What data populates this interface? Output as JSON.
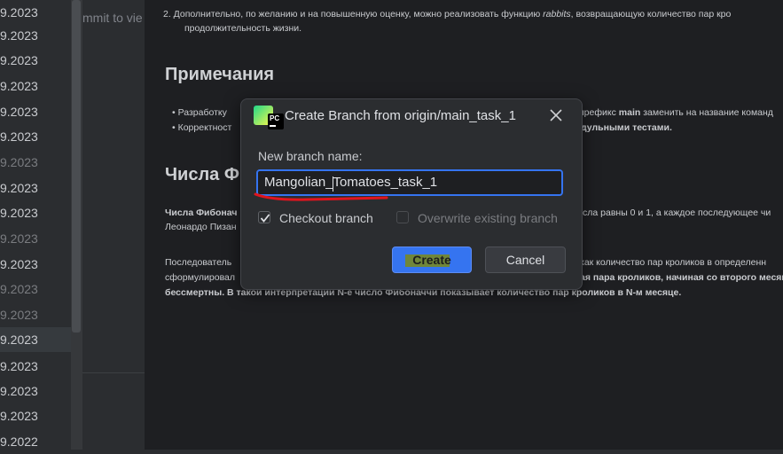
{
  "left_panel": {
    "dates": [
      {
        "text": "9.2023",
        "dim": false
      },
      {
        "text": "9.2023",
        "dim": false
      },
      {
        "text": "9.2023",
        "dim": false
      },
      {
        "text": "9.2023",
        "dim": false
      },
      {
        "text": "9.2023",
        "dim": false
      },
      {
        "text": "9.2023",
        "dim": false
      },
      {
        "text": "9.2023",
        "dim": true
      },
      {
        "text": "9.2023",
        "dim": false
      },
      {
        "text": "9.2023",
        "dim": false
      },
      {
        "text": "9.2023",
        "dim": true
      },
      {
        "text": "9.2023",
        "dim": false
      },
      {
        "text": "9.2023",
        "dim": true
      },
      {
        "text": "9.2023",
        "dim": true
      },
      {
        "text": "9.2023",
        "dim": false
      },
      {
        "text": "9.2023",
        "dim": false
      },
      {
        "text": "9.2023",
        "dim": false
      },
      {
        "text": "9.2023",
        "dim": false
      },
      {
        "text": "9.2022",
        "dim": false
      }
    ],
    "commit_hint": "mmit to vie"
  },
  "doc": {
    "item2_prefix": "2. Дополнительно, по желанию и на повышенную оценку, можно реализовать функцию",
    "item2_func": "rabbits",
    "item2_suffix": ", возвращающую количество пар кро",
    "item2_line2": "продолжительность жизни.",
    "notes_heading": "Примечания",
    "bullet1_a": "• Разработку",
    "bullet1_b": "префикс",
    "bullet1_c": "main",
    "bullet1_d": "заменить на название команд",
    "bullet2_a": "• Корректност",
    "bullet2_b": "дульными тестами.",
    "fib_heading": "Числа Ф",
    "fib_p1_a": "Числа Фибонач",
    "fib_p1_b": "сла равны 0 и 1, а каждое последующее чи",
    "fib_p1_line2": "Леонардо Пизан",
    "fib_p2_a": "Последователь",
    "fib_p2_b": "как количество пар кроликов в определенн",
    "fib_p2_line2a": "сформулировал",
    "fib_p2_line2b": "ая пара кроликов, начиная со второго месяц",
    "fib_p2_line3": "бессмертны. В такой интерпретации N-е число Фибоначчи показывает количество пар кроликов в N-м месяце."
  },
  "dialog": {
    "logo_text": "PC",
    "title": "Create Branch from origin/main_task_1",
    "new_branch_label": "New branch name:",
    "branch_name_value": "Mangolian_Tomatoes_task_1",
    "checkout_label": "Checkout branch",
    "checkout_checked": true,
    "overwrite_label": "Overwrite existing branch",
    "overwrite_checked": false,
    "create_label": "Create",
    "cancel_label": "Cancel"
  },
  "colors": {
    "accent_blue": "#3574f0",
    "annotation_red": "#e0141e",
    "highlight_green": "#7a8a1a"
  }
}
